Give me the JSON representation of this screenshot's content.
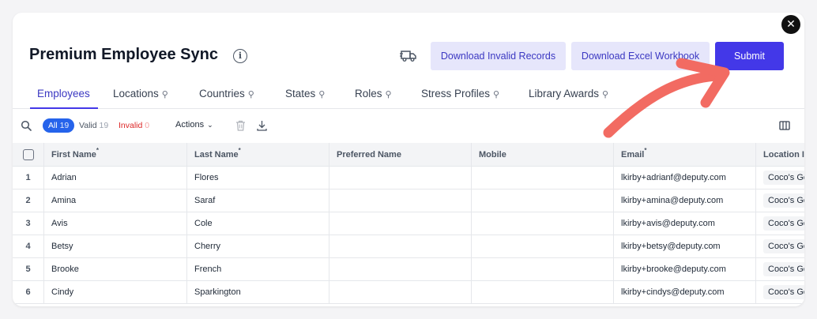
{
  "header": {
    "title": "Premium Employee Sync",
    "info_icon": "info-icon",
    "truck_icon": "truck-icon",
    "download_invalid_label": "Download Invalid Records",
    "download_excel_label": "Download Excel Workbook",
    "submit_label": "Submit",
    "close_icon": "close-icon"
  },
  "tabs": [
    {
      "label": "Employees",
      "active": true
    },
    {
      "label": "Locations",
      "pinned": true
    },
    {
      "label": "Countries",
      "pinned": true
    },
    {
      "label": "States",
      "pinned": true
    },
    {
      "label": "Roles",
      "pinned": true
    },
    {
      "label": "Stress Profiles",
      "pinned": true
    },
    {
      "label": "Library Awards",
      "pinned": true
    }
  ],
  "toolbar": {
    "all_label": "All",
    "all_count": "19",
    "valid_label": "Valid",
    "valid_count": "19",
    "invalid_label": "Invalid",
    "invalid_count": "0",
    "actions_label": "Actions"
  },
  "table": {
    "columns": [
      "First Name",
      "Last Name",
      "Preferred Name",
      "Mobile",
      "Email",
      "Location I"
    ],
    "required": [
      true,
      true,
      false,
      false,
      true,
      false
    ],
    "rows": [
      {
        "idx": "1",
        "first": "Adrian",
        "last": "Flores",
        "preferred": "",
        "mobile": "",
        "email": "lkirby+adrianf@deputy.com",
        "location": "Coco's Go"
      },
      {
        "idx": "2",
        "first": "Amina",
        "last": "Saraf",
        "preferred": "",
        "mobile": "",
        "email": "lkirby+amina@deputy.com",
        "location": "Coco's Go"
      },
      {
        "idx": "3",
        "first": "Avis",
        "last": "Cole",
        "preferred": "",
        "mobile": "",
        "email": "lkirby+avis@deputy.com",
        "location": "Coco's Go"
      },
      {
        "idx": "4",
        "first": "Betsy",
        "last": "Cherry",
        "preferred": "",
        "mobile": "",
        "email": "lkirby+betsy@deputy.com",
        "location": "Coco's Go"
      },
      {
        "idx": "5",
        "first": "Brooke",
        "last": "French",
        "preferred": "",
        "mobile": "",
        "email": "lkirby+brooke@deputy.com",
        "location": "Coco's Go"
      },
      {
        "idx": "6",
        "first": "Cindy",
        "last": "Sparkington",
        "preferred": "",
        "mobile": "",
        "email": "lkirby+cindys@deputy.com",
        "location": "Coco's Go"
      }
    ]
  },
  "colors": {
    "primary": "#4338e8",
    "secondary_bg": "#e6e6fb",
    "annotation_arrow": "#f26b62"
  }
}
